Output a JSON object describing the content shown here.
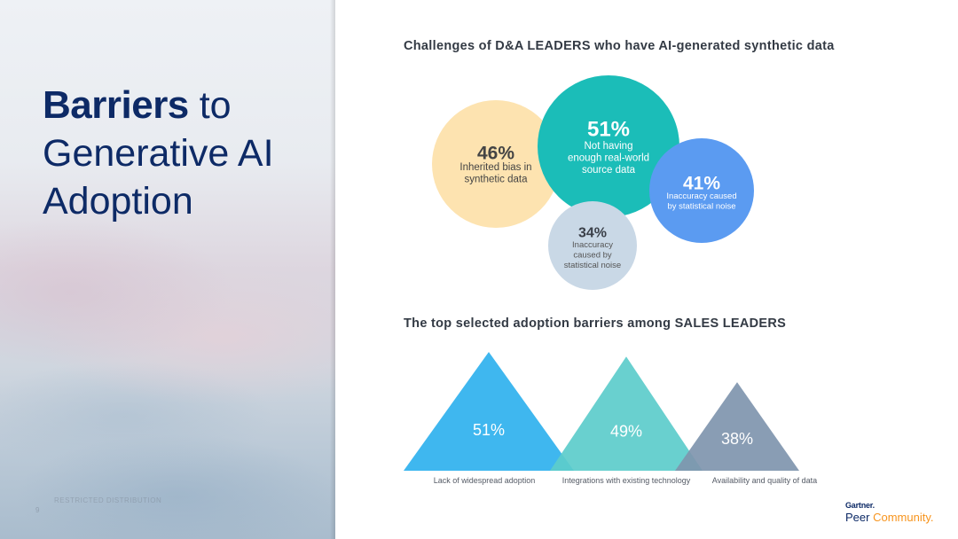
{
  "slide": {
    "title_bold": "Barriers",
    "title_rest_1": " to",
    "title_line2": "Generative AI",
    "title_line3": "Adoption",
    "restricted_label": "RESTRICTED DISTRIBUTION",
    "page_number": "9"
  },
  "brand": {
    "line1": "Gartner.",
    "peer": "Peer ",
    "community": "Community."
  },
  "colors": {
    "bubble_46": "#fde3b0",
    "bubble_51": "#1bbdb8",
    "bubble_41": "#5b9bf1",
    "bubble_34": "#c9d8e6",
    "tri_51": "#3fb7ef",
    "tri_49": "#5ccccb",
    "tri_38": "#7f95ae",
    "title_navy": "#0d2a66"
  },
  "chart_data": [
    {
      "type": "bubble",
      "title": "Challenges of D&A LEADERS who have AI-generated synthetic data",
      "items": [
        {
          "value": 46,
          "label_value": "46%",
          "label_lines": [
            "Inherited bias in",
            "synthetic data"
          ]
        },
        {
          "value": 51,
          "label_value": "51%",
          "label_lines": [
            "Not having",
            "enough real-world",
            "source data"
          ]
        },
        {
          "value": 41,
          "label_value": "41%",
          "label_lines": [
            "Inaccuracy caused",
            "by statistical noise"
          ]
        },
        {
          "value": 34,
          "label_value": "34%",
          "label_lines": [
            "Inaccuracy",
            "caused by",
            "statistical noise"
          ]
        }
      ]
    },
    {
      "type": "triangle",
      "title": "The top selected adoption barriers among SALES LEADERS",
      "categories": [
        "Lack of widespread adoption",
        "Integrations with existing technology",
        "Availability and quality of data"
      ],
      "values": [
        51,
        49,
        38
      ],
      "value_labels": [
        "51%",
        "49%",
        "38%"
      ]
    }
  ]
}
